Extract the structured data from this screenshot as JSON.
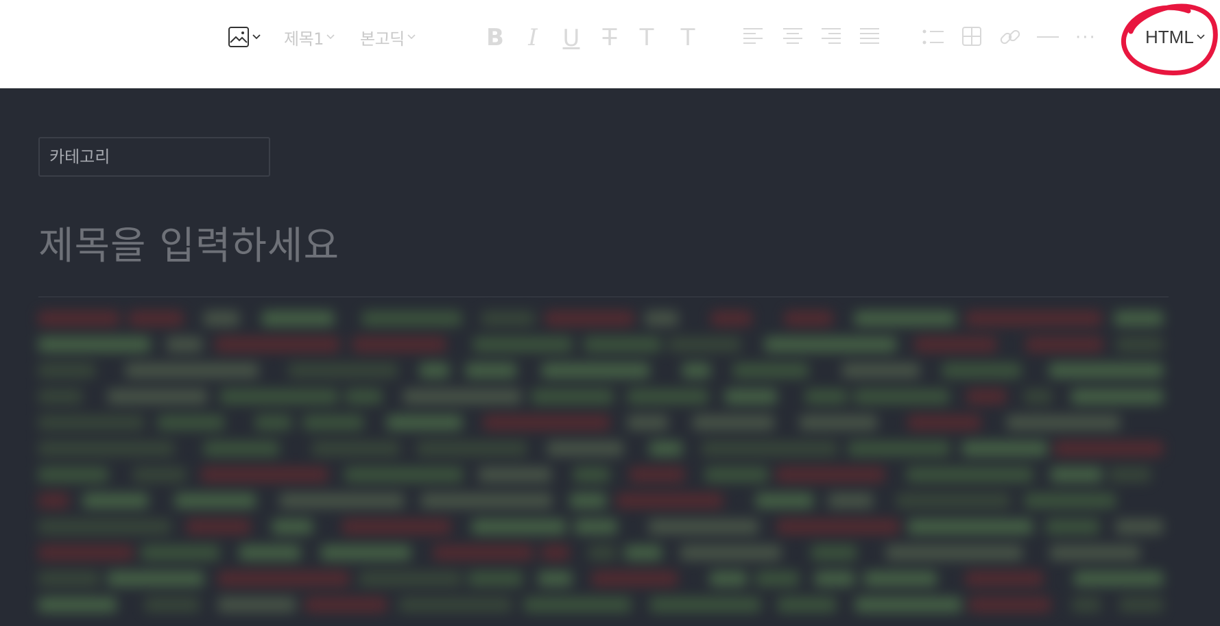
{
  "toolbar": {
    "heading_dropdown": "제목1",
    "font_dropdown": "본고딕",
    "bold_glyph": "B",
    "italic_glyph": "I",
    "underline_glyph": "U",
    "strike_glyph": "T",
    "color_glyph": "T",
    "bgcolor_glyph": "T",
    "more_glyph": "···",
    "mode_dropdown": "HTML"
  },
  "editor": {
    "category_placeholder": "카테고리",
    "title_placeholder": "제목을 입력하세요"
  },
  "colors": {
    "accent_circle": "#e8163f",
    "editor_bg": "#272b34",
    "toolbar_bg": "#ffffff"
  },
  "icons": [
    "image-icon",
    "chevron-down-icon",
    "bold-icon",
    "italic-icon",
    "underline-icon",
    "strikethrough-icon",
    "text-color-icon",
    "bg-color-icon",
    "align-left-icon",
    "align-center-icon",
    "align-right-icon",
    "align-justify-icon",
    "list-icon",
    "table-icon",
    "link-icon",
    "horizontal-rule-icon",
    "more-icon"
  ]
}
